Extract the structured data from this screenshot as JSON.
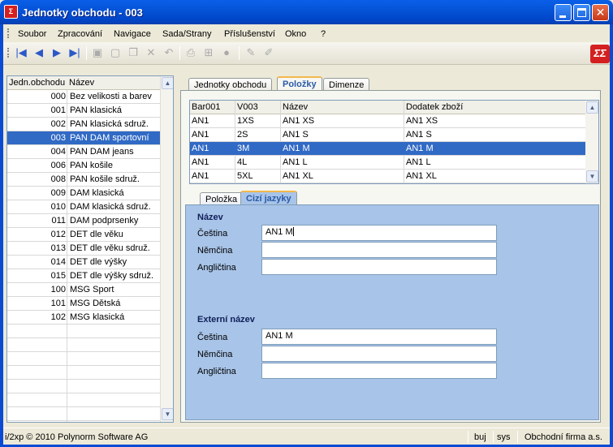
{
  "window": {
    "title": "Jednotky obchodu - 003",
    "app_icon": "Σ",
    "logo": "ΣΣ"
  },
  "menu": [
    "Soubor",
    "Zpracování",
    "Navigace",
    "Sada/Strany",
    "Příslušenství",
    "Okno",
    "?"
  ],
  "toolbar": {
    "icons": [
      "first-record-icon",
      "previous-record-icon",
      "next-record-icon",
      "last-record-icon",
      "save-icon",
      "new-record-icon",
      "copy-icon",
      "delete-icon",
      "undo-icon",
      "print-icon",
      "tree-icon",
      "stop-icon",
      "edit-icon",
      "edit-alt-icon"
    ],
    "glyphs": {
      "first": "|◀",
      "prev": "◀",
      "next": "▶",
      "last": "▶|",
      "save": "▣",
      "new": "▢",
      "copy": "❐",
      "delete": "✕",
      "undo": "↶",
      "print": "⎙",
      "tree": "⊞",
      "stop": "●",
      "edit": "✎",
      "edit2": "✐"
    }
  },
  "left_list": {
    "headers": [
      "Jedn.obchodu",
      "Název"
    ],
    "rows": [
      {
        "code": "000",
        "name": "Bez velikosti a barev"
      },
      {
        "code": "001",
        "name": "PAN klasická"
      },
      {
        "code": "002",
        "name": "PAN klasická sdruž."
      },
      {
        "code": "003",
        "name": "PAN DAM sportovní",
        "selected": true
      },
      {
        "code": "004",
        "name": "PAN DAM jeans"
      },
      {
        "code": "006",
        "name": "PAN košile"
      },
      {
        "code": "008",
        "name": "PAN košile sdruž."
      },
      {
        "code": "009",
        "name": "DAM klasická"
      },
      {
        "code": "010",
        "name": "DAM klasická sdruž."
      },
      {
        "code": "011",
        "name": "DAM podprsenky"
      },
      {
        "code": "012",
        "name": "DET dle věku"
      },
      {
        "code": "013",
        "name": "DET dle věku sdruž."
      },
      {
        "code": "014",
        "name": "DET dle výšky"
      },
      {
        "code": "015",
        "name": "DET dle výšky sdruž."
      },
      {
        "code": "100",
        "name": "MSG Sport"
      },
      {
        "code": "101",
        "name": "MSG Dětská"
      },
      {
        "code": "102",
        "name": "MSG klasická"
      },
      {
        "code": "",
        "name": ""
      },
      {
        "code": "",
        "name": ""
      },
      {
        "code": "",
        "name": ""
      },
      {
        "code": "",
        "name": ""
      },
      {
        "code": "",
        "name": ""
      },
      {
        "code": "",
        "name": ""
      },
      {
        "code": "",
        "name": ""
      }
    ]
  },
  "tabs": [
    {
      "label": "Jednotky obchodu",
      "active": false
    },
    {
      "label": "Položky",
      "active": true
    },
    {
      "label": "Dimenze",
      "active": false
    }
  ],
  "items_grid": {
    "headers": [
      "Bar001",
      "V003",
      "Název",
      "Dodatek zboží"
    ],
    "rows": [
      [
        "AN1",
        "1XS",
        "AN1 XS",
        "AN1 XS"
      ],
      [
        "AN1",
        "2S",
        "AN1 S",
        "AN1 S"
      ],
      [
        "AN1",
        "3M",
        "AN1 M",
        "AN1 M"
      ],
      [
        "AN1",
        "4L",
        "AN1 L",
        "AN1 L"
      ],
      [
        "AN1",
        "5XL",
        "AN1 XL",
        "AN1 XL"
      ]
    ],
    "selected_index": 2
  },
  "sub_tabs": [
    {
      "label": "Položka",
      "active": false
    },
    {
      "label": "Cizí jazyky",
      "active": true
    }
  ],
  "form": {
    "name_section": {
      "title": "Název",
      "fields": [
        {
          "label": "Čeština",
          "value": "AN1 M",
          "focused": true
        },
        {
          "label": "Němčina",
          "value": ""
        },
        {
          "label": "Angličtina",
          "value": ""
        }
      ]
    },
    "external_section": {
      "title": "Externí název",
      "fields": [
        {
          "label": "Čeština",
          "value": "AN1 M"
        },
        {
          "label": "Němčina",
          "value": ""
        },
        {
          "label": "Angličtina",
          "value": ""
        }
      ]
    }
  },
  "status": {
    "copyright": "i/2xp © 2010 Polynorm Software AG",
    "user": "buj",
    "system": "sys",
    "company": "Obchodní firma a.s."
  },
  "scroll": {
    "up": "▲",
    "down": "▼"
  },
  "window_buttons": {
    "close": "✕"
  }
}
